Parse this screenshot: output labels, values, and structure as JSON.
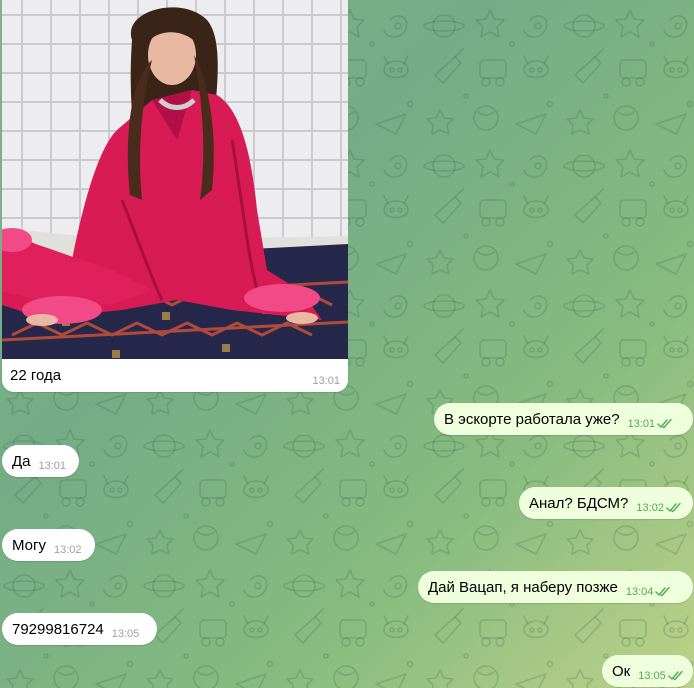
{
  "colors": {
    "wallpaper_start": "#7fb58a",
    "wallpaper_end": "#b7cf86",
    "incoming_bubble": "#ffffff",
    "outgoing_bubble": "#effedd",
    "outgoing_time": "#4fae4e",
    "incoming_time": "#a0a0a0"
  },
  "messages": {
    "photo": {
      "caption": "22 года",
      "time": "13:01",
      "image": "photo-woman-in-pink-pajamas-icon"
    },
    "m1": {
      "direction": "outgoing",
      "text": "В эскорте работала уже?",
      "time": "13:01",
      "status": "read"
    },
    "m2": {
      "direction": "incoming",
      "text": "Да",
      "time": "13:01"
    },
    "m3": {
      "direction": "outgoing",
      "text": "Анал? БДСМ?",
      "time": "13:02",
      "status": "read"
    },
    "m4": {
      "direction": "incoming",
      "text": "Могу",
      "time": "13:02"
    },
    "m5": {
      "direction": "outgoing",
      "text": "Дай Вацап, я наберу позже",
      "time": "13:04",
      "status": "read"
    },
    "m6": {
      "direction": "incoming",
      "text": "79299816724",
      "time": "13:05"
    },
    "m7": {
      "direction": "outgoing",
      "text": "Ок",
      "time": "13:05",
      "status": "read"
    }
  }
}
